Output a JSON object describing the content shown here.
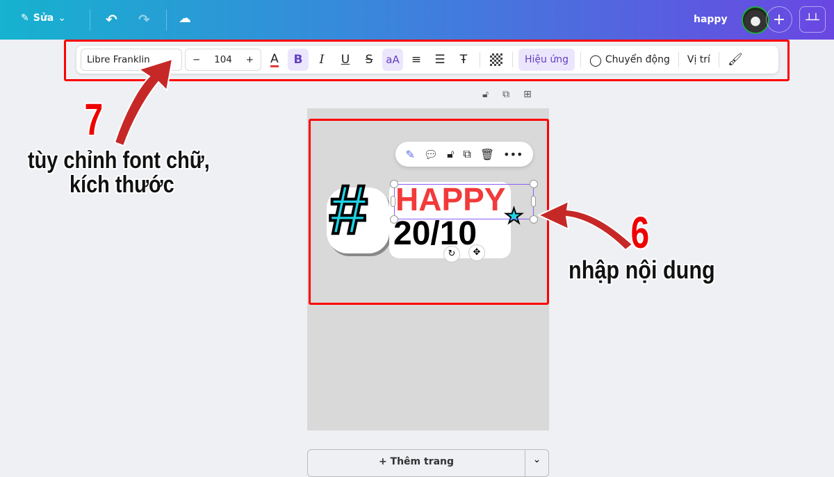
{
  "header": {
    "edit_label": "Sửa",
    "design_title": "happy",
    "icons": [
      "pencil-icon",
      "chevron-down-icon",
      "undo-icon",
      "redo-icon",
      "cloud-save-icon",
      "avatar",
      "plus-icon",
      "chart-icon"
    ]
  },
  "toolbar": {
    "font": "Libre Franklin",
    "font_size": "104",
    "minus": "−",
    "plus": "+",
    "bold": "B",
    "italic": "I",
    "underline": "U",
    "strike": "S",
    "case": "aA",
    "effects": "Hiệu ứng",
    "animate": "Chuyển động",
    "position": "Vị trí"
  },
  "canvas": {
    "line1": "HAPPY",
    "line2": "20/10",
    "hash": "#"
  },
  "add_page": "+ Thêm trang",
  "annotations": {
    "n7": "7",
    "t7a": "tùy chỉnh font chữ,",
    "t7b": "kích thước",
    "n6": "6",
    "t6": "nhập nội dung"
  },
  "colors": {
    "accent": "#7d4cdb",
    "highlight": "#ff0000",
    "happy": "#f23a3a",
    "hash": "#1fd3e6"
  }
}
